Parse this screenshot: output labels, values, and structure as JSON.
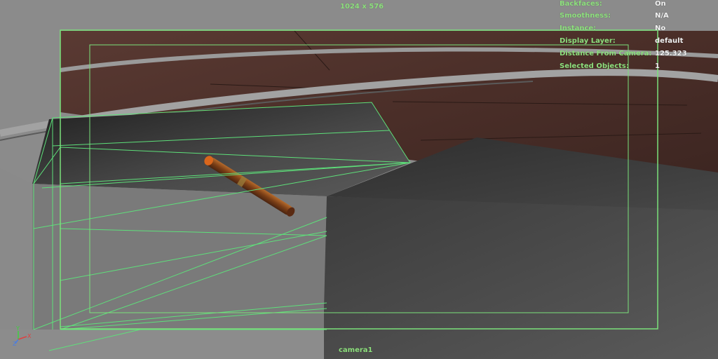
{
  "viewport": {
    "resolution_label": "1024 x 576",
    "camera_name": "camera1"
  },
  "hud": {
    "rows": [
      {
        "label": "Backfaces:",
        "value": "On"
      },
      {
        "label": "Smoothness:",
        "value": "N/A"
      },
      {
        "label": "Instance:",
        "value": "No"
      },
      {
        "label": "Display Layer:",
        "value": "default"
      },
      {
        "label": "Distance From Camera:",
        "value": "125.323"
      },
      {
        "label": "Selected Objects:",
        "value": "1"
      }
    ]
  },
  "axis_gizmo": {
    "y_label": "Y",
    "z_label": "Z",
    "x_label": "X"
  },
  "colors": {
    "hud_label": "#8ee07e",
    "hud_value": "#f2f2f2",
    "gate_line": "#7be27b",
    "wireframe": "#5ee07a",
    "floor_wood": "#4a302a",
    "box_dark": "#3a3a3a",
    "cigarette": "#8a4a1f"
  }
}
